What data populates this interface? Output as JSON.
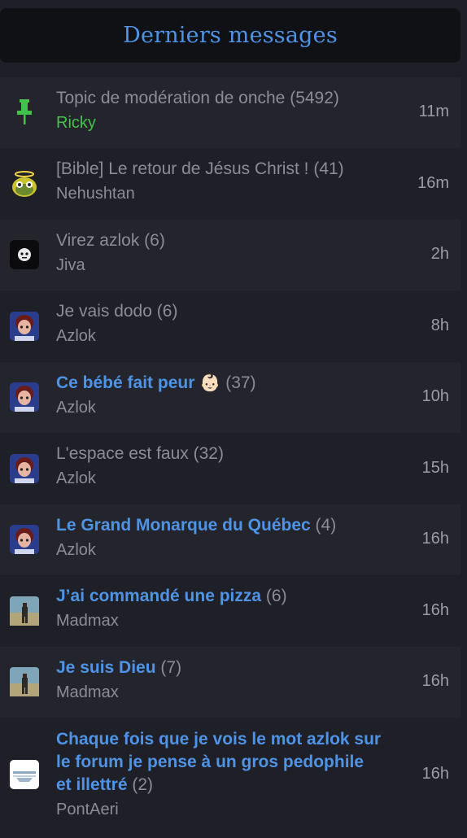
{
  "header": {
    "title": "Derniers messages"
  },
  "colors": {
    "accent_blue": "#4f93e6",
    "moderator_green": "#43c24b",
    "muted_text": "#8a8d96",
    "background": "#1f2027",
    "header_bg": "#101114"
  },
  "topics": [
    {
      "title": "Topic de modération de onche",
      "count": "(5492)",
      "author": "Ricky",
      "time": "11m",
      "hot": false,
      "author_role": "moderator",
      "icon": "pin-icon"
    },
    {
      "title": "[Bible] Le retour de Jésus Christ !",
      "count": "(41)",
      "author": "Nehushtan",
      "time": "16m",
      "hot": false,
      "icon": "halo-avatar-icon"
    },
    {
      "title": "Virez azlok",
      "count": "(6)",
      "author": "Jiva",
      "time": "2h",
      "hot": false,
      "icon": "ghost-avatar-icon"
    },
    {
      "title": "Je vais dodo",
      "count": "(6)",
      "author": "Azlok",
      "time": "8h",
      "hot": false,
      "icon": "azlok-avatar-icon"
    },
    {
      "title": "Ce bébé fait peur 👶🏻",
      "count": "(37)",
      "author": "Azlok",
      "time": "10h",
      "hot": true,
      "icon": "azlok-avatar-icon"
    },
    {
      "title": "L'espace est faux",
      "count": "(32)",
      "author": "Azlok",
      "time": "15h",
      "hot": false,
      "icon": "azlok-avatar-icon"
    },
    {
      "title": "Le Grand Monarque du Québec",
      "count": "(4)",
      "author": "Azlok",
      "time": "16h",
      "hot": true,
      "icon": "azlok-avatar-icon"
    },
    {
      "title": "J’ai commandé une pizza",
      "count": "(6)",
      "author": "Madmax",
      "time": "16h",
      "hot": true,
      "icon": "madmax-avatar-icon"
    },
    {
      "title": "Je suis Dieu",
      "count": "(7)",
      "author": "Madmax",
      "time": "16h",
      "hot": true,
      "icon": "madmax-avatar-icon"
    },
    {
      "title": "Chaque fois que je vois le mot azlok sur le forum je pense à un gros pedophile et illettré",
      "count": "(2)",
      "author": "PontAeri",
      "time": "16h",
      "hot": true,
      "icon": "pontaeri-avatar-icon"
    }
  ]
}
